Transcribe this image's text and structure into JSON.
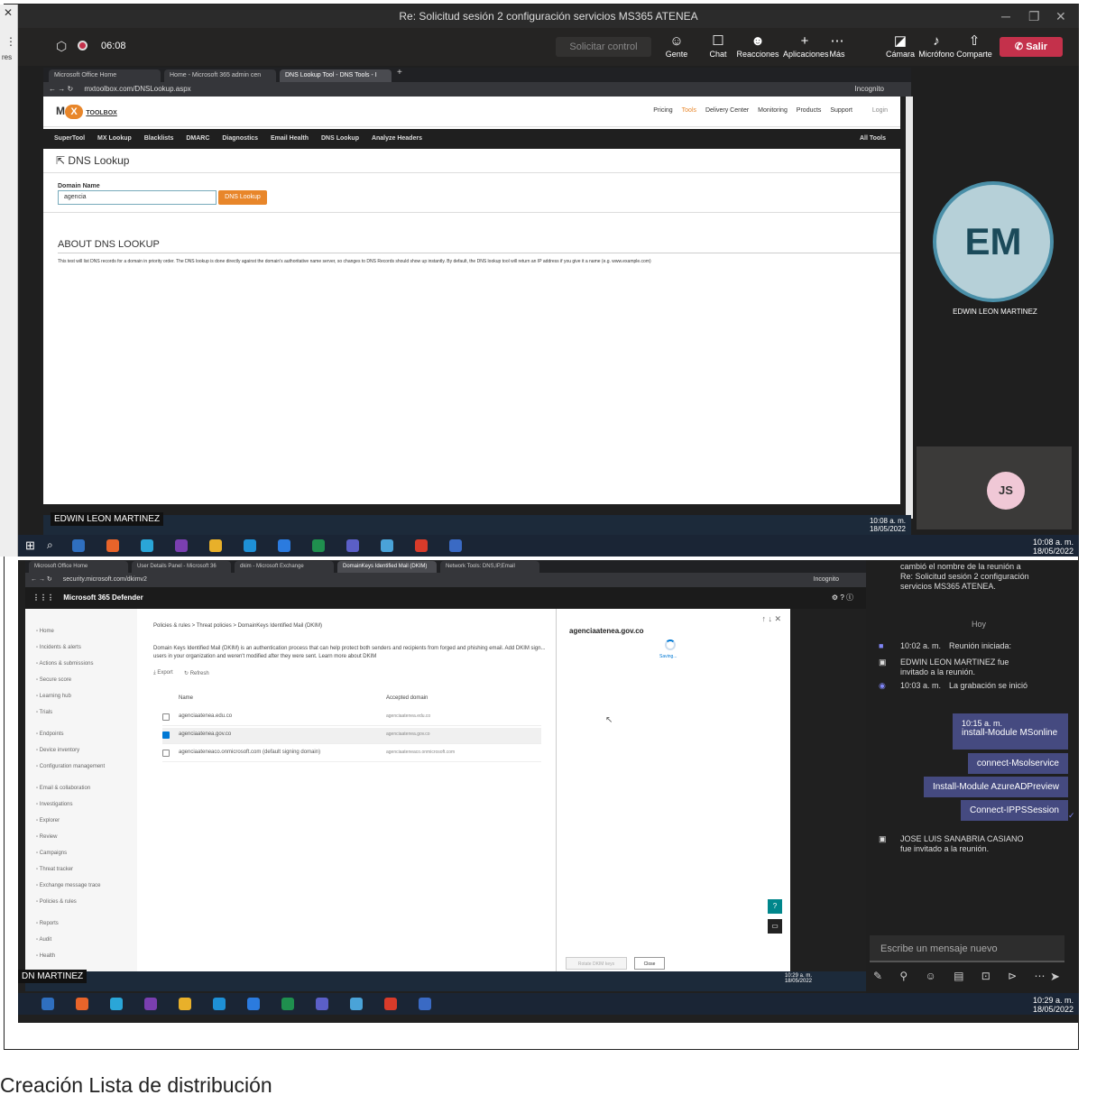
{
  "shot1": {
    "window_title": "Re: Solicitud sesión 2 configuración servicios MS365 ATENEA",
    "meeting_timer": "06:08",
    "request_control": "Solicitar control",
    "toolbar": [
      {
        "label": "Gente",
        "icon": "people-icon"
      },
      {
        "label": "Chat",
        "icon": "chat-icon"
      },
      {
        "label": "Reacciones",
        "icon": "reactions-icon"
      },
      {
        "label": "Aplicaciones",
        "icon": "apps-icon"
      },
      {
        "label": "Más",
        "icon": "more-icon"
      },
      {
        "label": "Cámara",
        "icon": "camera-off-icon"
      },
      {
        "label": "Micrófono",
        "icon": "mic-icon"
      },
      {
        "label": "Comparte",
        "icon": "share-icon"
      }
    ],
    "leave_label": "Salir",
    "left_strip_text": "res",
    "browser_tabs": [
      "Microsoft Office Home",
      "Home - Microsoft 365 admin cen",
      "DNS Lookup Tool - DNS Tools - I"
    ],
    "url": "mxtoolbox.com/DNSLookup.aspx",
    "incognito": "Incognito",
    "mx": {
      "logo": "TOOLBOX",
      "top_nav": [
        "Pricing",
        "Tools",
        "Delivery Center",
        "Monitoring",
        "Products",
        "Support",
        "Login"
      ],
      "nav": [
        "SuperTool",
        "MX Lookup",
        "Blacklists",
        "DMARC",
        "Diagnostics",
        "Email Health",
        "DNS Lookup",
        "Analyze Headers"
      ],
      "nav_right": "All Tools",
      "page_title": "DNS Lookup",
      "field_label": "Domain Name",
      "field_value": "agencia",
      "button": "DNS Lookup",
      "about_title": "ABOUT DNS LOOKUP",
      "about_text": "This test will list DNS records for a domain in priority order. The DNS lookup is done directly against the domain's authoritative name server, so changes to DNS Records should show up instantly. By default, the DNS lookup tool will return an IP address if you give it a name (e.g. www.example.com)"
    },
    "presenter_tag": "EDWIN LEON MARTINEZ",
    "inner_clock": {
      "time": "10:08 a. m.",
      "date": "18/05/2022"
    },
    "participant_main": {
      "initials": "EM",
      "name": "EDWIN LEON MARTINEZ"
    },
    "participant_small": {
      "initials": "JS"
    },
    "clock": {
      "time": "10:08 a. m.",
      "date": "18/05/2022"
    }
  },
  "shot2": {
    "browser_tabs": [
      "Microsoft Office Home",
      "User Details Panel - Microsoft 36",
      "dkim - Microsoft Exchange",
      "DomainKeys Identified Mail (DKIM)",
      "Network Tools: DNS,IP,Email"
    ],
    "url": "security.microsoft.com/dkimv2",
    "incognito": "Incognito",
    "app_title": "Microsoft 365 Defender",
    "sidebar": [
      "Home",
      "Incidents & alerts",
      "Actions & submissions",
      "Secure score",
      "Learning hub",
      "Trials",
      "Endpoints",
      "Device inventory",
      "Configuration management",
      "Email & collaboration",
      "Investigations",
      "Explorer",
      "Review",
      "Campaigns",
      "Threat tracker",
      "Exchange message trace",
      "Policies & rules",
      "Reports",
      "Audit",
      "Health"
    ],
    "breadcrumb": "Policies & rules  >  Threat policies  >  DomainKeys Identified Mail (DKIM)",
    "description": "Domain Keys Identified Mail (DKIM) is an authentication process that can help protect both senders and recipients from forged and phishing email. Add DKIM sign... users in your organization and weren't modified after they were sent. Learn more about DKIM",
    "actions": [
      "Export",
      "Refresh"
    ],
    "columns": [
      "Name",
      "Accepted domain"
    ],
    "rows": [
      {
        "name": "agenciaatenea.edu.co",
        "domain": "agenciaatenea.edu.co",
        "checked": false
      },
      {
        "name": "agenciaatenea.gov.co",
        "domain": "agenciaatenea.gov.co",
        "checked": true
      },
      {
        "name": "agenciaateneaco.onmicrosoft.com (default signing domain)",
        "domain": "agenciaateneaco.onmicrosoft.com",
        "checked": false
      }
    ],
    "panel": {
      "title": "agenciaatenea.gov.co",
      "status": "Saving...",
      "btn_rotate": "Rotate DKIM keys",
      "btn_close": "Close"
    },
    "presenter_tag": "DN MARTINEZ",
    "inner_clock": {
      "time": "10:29 a. m.",
      "date": "18/05/2022"
    },
    "chat": {
      "rename_event": "cambió el nombre de la reunión a Re: Solicitud sesión 2 configuración servicios MS365 ATENEA.",
      "divider": "Hoy",
      "events": [
        {
          "time": "10:02 a. m.",
          "text": "Reunión iniciada:"
        },
        {
          "text": "EDWIN LEON MARTINEZ fue invitado a la reunión."
        },
        {
          "time": "10:03 a. m.",
          "text": "La grabación se inició"
        }
      ],
      "my_time": "10:15 a. m.",
      "messages": [
        "install-Module MSonline",
        "connect-Msolservice",
        "Install-Module AzureADPreview",
        "Connect-IPPSSession"
      ],
      "invite2": "JOSE LUIS SANABRIA CASIANO fue invitado a la reunión.",
      "input_placeholder": "Escribe un mensaje nuevo"
    },
    "clock": {
      "time": "10:29 a. m.",
      "date": "18/05/2022"
    }
  },
  "caption": "Creación Lista de distribución"
}
